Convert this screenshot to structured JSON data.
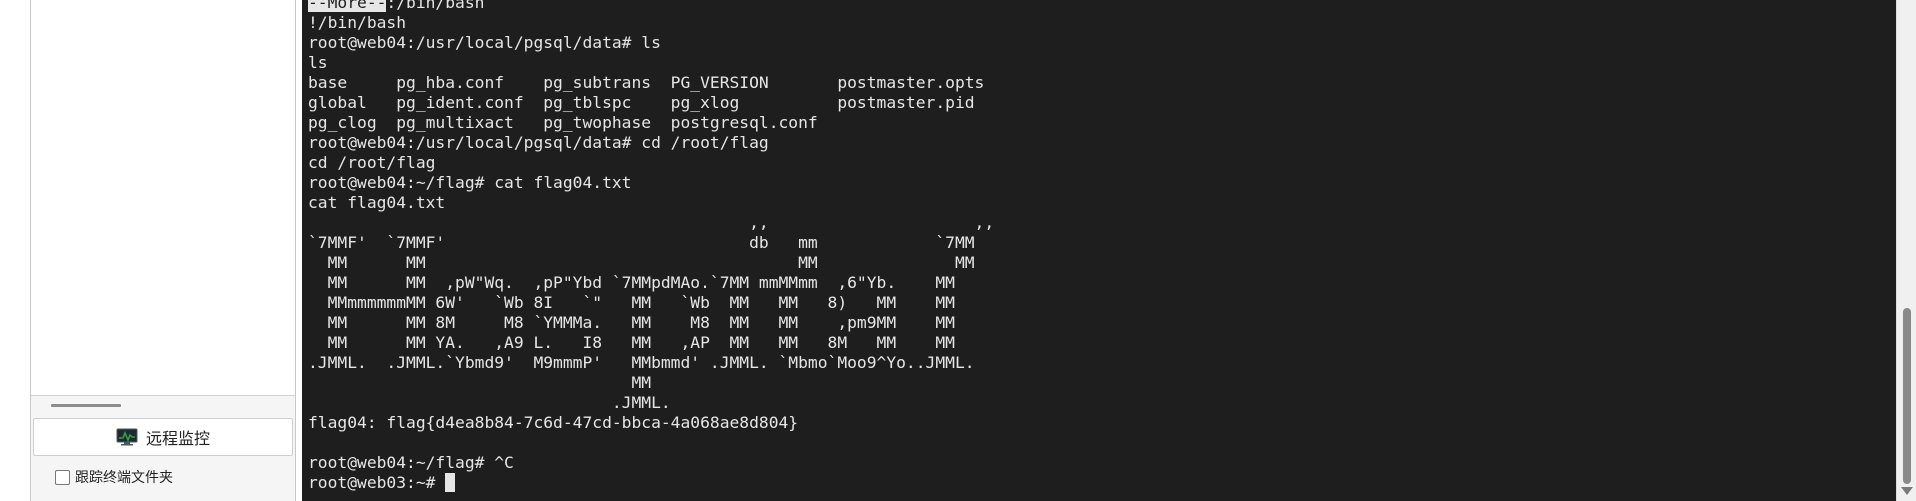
{
  "sidebar": {
    "remote_monitor_label": "远程监控",
    "remote_monitor_icon": "monitor-chart-icon",
    "follow_terminal_label": "跟踪终端文件夹",
    "follow_terminal_checked": false
  },
  "terminal": {
    "more_prompt": "--More--",
    "lines": [
      ":/bin/bash",
      "!/bin/bash",
      "root@web04:/usr/local/pgsql/data# ls",
      "ls",
      "base     pg_hba.conf    pg_subtrans  PG_VERSION       postmaster.opts",
      "global   pg_ident.conf  pg_tblspc    pg_xlog          postmaster.pid",
      "pg_clog  pg_multixact   pg_twophase  postgresql.conf",
      "root@web04:/usr/local/pgsql/data# cd /root/flag",
      "cd /root/flag",
      "root@web04:~/flag# cat flag04.txt",
      "cat flag04.txt",
      "                                             ,,                     ,,",
      "`7MMF'  `7MMF'                               db   mm            `7MM",
      "  MM      MM                                      MM              MM",
      "  MM      MM  ,pW\"Wq.  ,pP\"Ybd `7MMpdMAo.`7MM mmMMmm  ,6\"Yb.    MM",
      "  MMmmmmmmMM 6W'   `Wb 8I   `\"   MM   `Wb  MM   MM   8)   MM    MM",
      "  MM      MM 8M     M8 `YMMMa.   MM    M8  MM   MM    ,pm9MM    MM",
      "  MM      MM YA.   ,A9 L.   I8   MM   ,AP  MM   MM   8M   MM    MM",
      ".JMML.  .JMML.`Ybmd9'  M9mmmP'   MMbmmd' .JMML. `Mbmo`Moo9^Yo..JMML.",
      "                                 MM",
      "                               .JMML.",
      "flag04: flag{d4ea8b84-7c6d-47cd-bbca-4a068ae8d804}",
      "",
      "root@web04:~/flag# ^C",
      "root@web03:~# "
    ]
  },
  "colors": {
    "terminal_bg": "#1e1e1e",
    "terminal_fg": "#e6e6e6",
    "sidebar_bg": "#f5f5f5",
    "monitor_icon_green": "#2ea043"
  }
}
